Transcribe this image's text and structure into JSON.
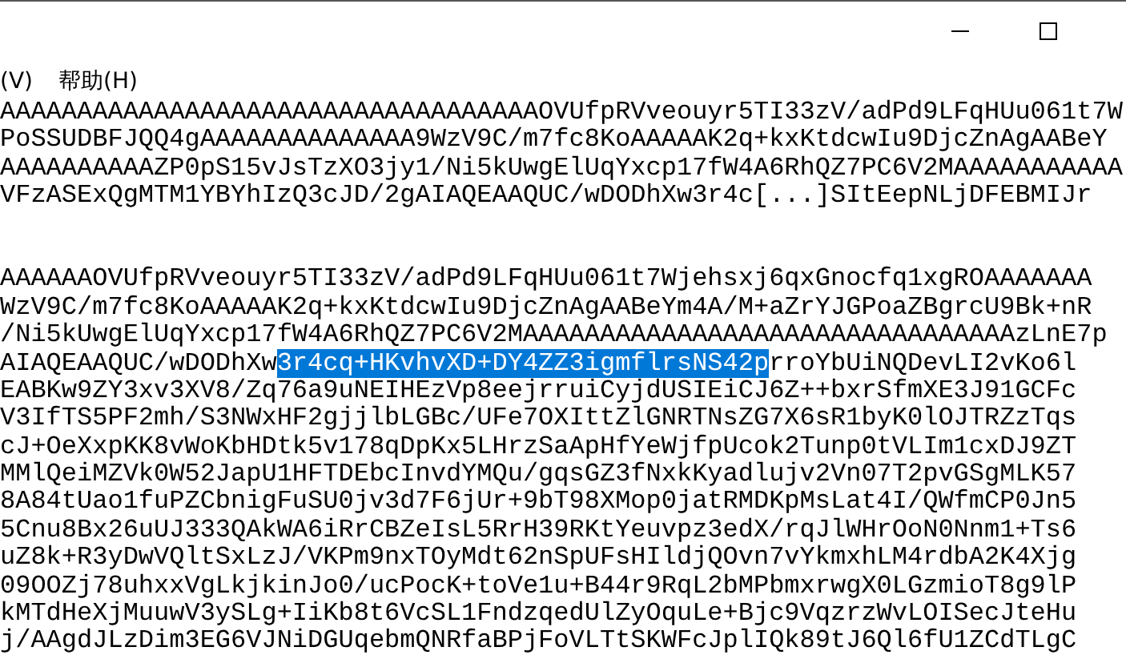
{
  "window": {
    "controls": [
      {
        "kind": "minimize"
      },
      {
        "kind": "maximize"
      }
    ]
  },
  "menu": [
    "(V)",
    "帮助(H)"
  ],
  "editor": {
    "blocks": [
      {
        "lines": [
          {
            "segments": [
              {
                "text": "AAAAAAAAAAAAAAAAAAAAAAAAAAAAAAAAAAAOVUfpRVveouyr5TI33zV/adPd9LFqHUu061t7W",
                "selected": false
              }
            ]
          },
          {
            "segments": [
              {
                "text": "PoSSUDBFJQQ4gAAAAAAAAAAAAAA9WzV9C/m7fc8KoAAAAAK2q+kxKtdcwIu9DjcZnAgAABeY",
                "selected": false
              }
            ]
          },
          {
            "segments": [
              {
                "text": "AAAAAAAAAAZP0pS15vJsTzXO3jy1/Ni5kUwgElUqYxcp17fW4A6RhQZ7PC6V2MAAAAAAAAAAA",
                "selected": false
              }
            ]
          },
          {
            "segments": [
              {
                "text": "VFzASExQgMTM1YBYhIzQ3cJD/2gAIAQEAAQUC/wDODhXw3r4c[...]SItEepNLjDFEBMIJr",
                "selected": false
              }
            ]
          }
        ]
      },
      {
        "lines": [
          {
            "segments": [
              {
                "text": "AAAAAAOVUfpRVveouyr5TI33zV/adPd9LFqHUu061t7Wjehsxj6qxGnocfq1xgROAAAAAAA",
                "selected": false
              }
            ]
          },
          {
            "segments": [
              {
                "text": "WzV9C/m7fc8KoAAAAAK2q+kxKtdcwIu9DjcZnAgAABeYm4A/M+aZrYJGPoaZBgrcU9Bk+nR",
                "selected": false
              }
            ]
          },
          {
            "segments": [
              {
                "text": "/Ni5kUwgElUqYxcp17fW4A6RhQZ7PC6V2MAAAAAAAAAAAAAAAAAAAAAAAAAAAAAAAAzLnE7p",
                "selected": false
              }
            ]
          },
          {
            "segments": [
              {
                "text": "AIAQEAAQUC/wDODhXw",
                "selected": false
              },
              {
                "text": "3r4cq+HKvhvXD+DY4ZZ3igmflrsNS42p",
                "selected": true
              },
              {
                "text": "rroYbUiNQDevLI2vKo6l",
                "selected": false
              }
            ]
          },
          {
            "segments": [
              {
                "text": "EABKw9ZY3xv3XV8/Zq76a9uNEIHEzVp8eejrruiCyjdUSIEiCJ6Z++bxrSfmXE3J91GCFc",
                "selected": false
              }
            ]
          },
          {
            "segments": [
              {
                "text": "V3IfTS5PF2mh/S3NWxHF2gjjlbLGBc/UFe7OXIttZlGNRTNsZG7X6sR1byK0lOJTRZzTqs",
                "selected": false
              }
            ]
          },
          {
            "segments": [
              {
                "text": "cJ+OeXxpKK8vWoKbHDtk5v178qDpKx5LHrzSaApHfYeWjfpUcok2Tunp0tVLIm1cxDJ9ZT",
                "selected": false
              }
            ]
          },
          {
            "segments": [
              {
                "text": "MMlQeiMZVk0W52JapU1HFTDEbcInvdYMQu/gqsGZ3fNxkKyadlujv2Vn07T2pvGSgMLK57",
                "selected": false
              }
            ]
          },
          {
            "segments": [
              {
                "text": "8A84tUao1fuPZCbnigFuSU0jv3d7F6jUr+9bT98XMop0jatRMDKpMsLat4I/QWfmCP0Jn5",
                "selected": false
              }
            ]
          },
          {
            "segments": [
              {
                "text": "5Cnu8Bx26uUJ333QAkWA6iRrCBZeIsL5RrH39RKtYeuvpz3edX/rqJlWHrOoN0Nnm1+Ts6",
                "selected": false
              }
            ]
          },
          {
            "segments": [
              {
                "text": "uZ8k+R3yDwVQltSxLzJ/VKPm9nxTOyMdt62nSpUFsHIldjQOvn7vYkmxhLM4rdbA2K4Xjg",
                "selected": false
              }
            ]
          },
          {
            "segments": [
              {
                "text": "09OOZj78uhxxVgLkjkinJo0/ucPocK+toVe1u+B44r9RqL2bMPbmxrwgX0LGzmioT8g9lP",
                "selected": false
              }
            ]
          },
          {
            "segments": [
              {
                "text": "kMTdHeXjMuuwV3ySLg+IiKb8t6VcSL1FndzqedUlZyOquLe+Bjc9VqzrzWvLOISecJteHu",
                "selected": false
              }
            ]
          },
          {
            "segments": [
              {
                "text": "j/AAgdJLzDim3EG6VJNiDGUqebmQNRfaBPjFoVLTtSKWFcJplIQk89tJ6Ql6fU1ZCdTLgC",
                "selected": false
              }
            ]
          }
        ]
      }
    ]
  }
}
